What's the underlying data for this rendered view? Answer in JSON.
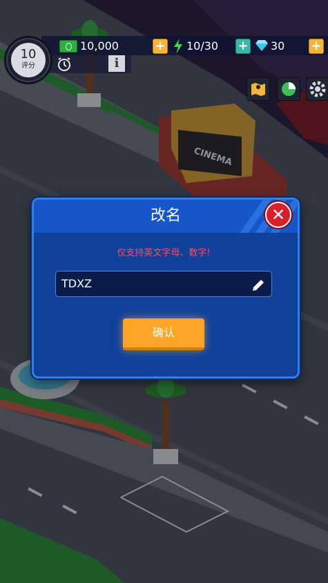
{
  "hud": {
    "level": "10",
    "level_label": "评分",
    "cash": "10,000",
    "energy": "10/30",
    "gems": "30",
    "plus": "+",
    "info": "i"
  },
  "world": {
    "sign_text": "CINEMA"
  },
  "dialog": {
    "title": "改名",
    "close": "✕",
    "warning": "仅支持英文字母、数字!",
    "input_value": "TDXZ",
    "confirm_label": "确认"
  },
  "colors": {
    "dialog_bg": "#10419a",
    "dialog_border": "#2f7fe8",
    "warning": "#ff4b5e",
    "confirm": "#fca529",
    "close": "#d8202a"
  }
}
